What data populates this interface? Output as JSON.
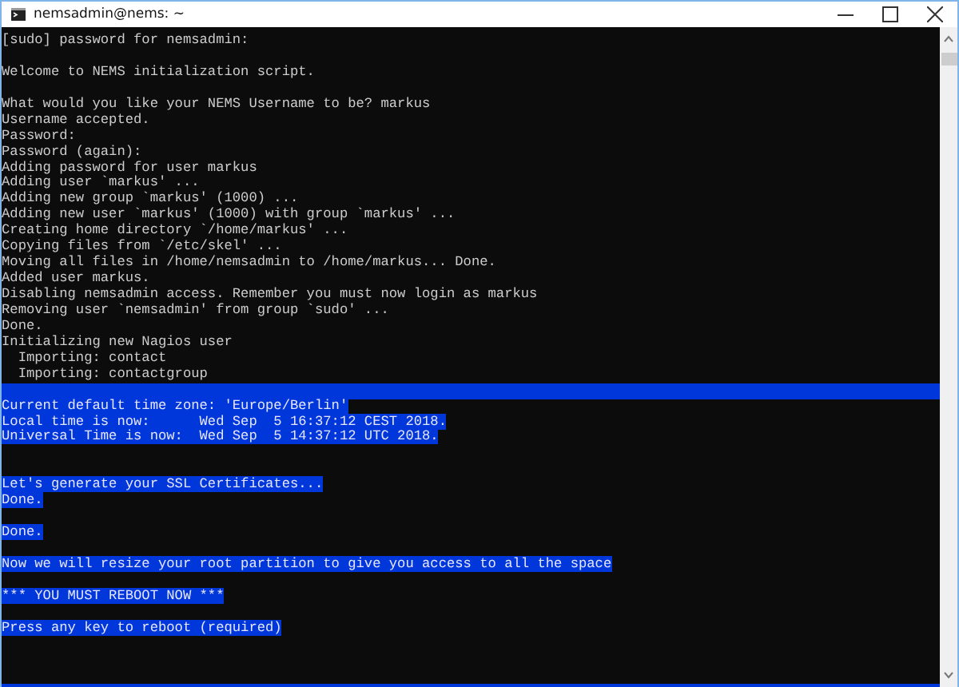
{
  "window": {
    "title": "nemsadmin@nems: ~"
  },
  "terminal": {
    "lines": [
      {
        "kind": "text",
        "text": "[sudo] password for nemsadmin:",
        "highlighted": false
      },
      {
        "kind": "blank"
      },
      {
        "kind": "text",
        "text": "Welcome to NEMS initialization script.",
        "highlighted": false
      },
      {
        "kind": "blank"
      },
      {
        "kind": "text",
        "text": "What would you like your NEMS Username to be? markus",
        "highlighted": false
      },
      {
        "kind": "text",
        "text": "Username accepted.",
        "highlighted": false
      },
      {
        "kind": "text",
        "text": "Password:",
        "highlighted": false
      },
      {
        "kind": "text",
        "text": "Password (again):",
        "highlighted": false
      },
      {
        "kind": "text",
        "text": "Adding password for user markus",
        "highlighted": false
      },
      {
        "kind": "text",
        "text": "Adding user `markus' ...",
        "highlighted": false
      },
      {
        "kind": "text",
        "text": "Adding new group `markus' (1000) ...",
        "highlighted": false
      },
      {
        "kind": "text",
        "text": "Adding new user `markus' (1000) with group `markus' ...",
        "highlighted": false
      },
      {
        "kind": "text",
        "text": "Creating home directory `/home/markus' ...",
        "highlighted": false
      },
      {
        "kind": "text",
        "text": "Copying files from `/etc/skel' ...",
        "highlighted": false
      },
      {
        "kind": "text",
        "text": "Moving all files in /home/nemsadmin to /home/markus... Done.",
        "highlighted": false
      },
      {
        "kind": "text",
        "text": "Added user markus.",
        "highlighted": false
      },
      {
        "kind": "text",
        "text": "Disabling nemsadmin access. Remember you must now login as markus",
        "highlighted": false
      },
      {
        "kind": "text",
        "text": "Removing user `nemsadmin' from group `sudo' ...",
        "highlighted": false
      },
      {
        "kind": "text",
        "text": "Done.",
        "highlighted": false
      },
      {
        "kind": "text",
        "text": "Initializing new Nagios user",
        "highlighted": false
      },
      {
        "kind": "text",
        "text": "  Importing: contact",
        "highlighted": false
      },
      {
        "kind": "text",
        "text": "  Importing: contactgroup",
        "highlighted": false
      },
      {
        "kind": "band"
      },
      {
        "kind": "text",
        "text": "Current default time zone: 'Europe/Berlin'",
        "highlighted": true
      },
      {
        "kind": "text",
        "text": "Local time is now:      Wed Sep  5 16:37:12 CEST 2018.",
        "highlighted": true
      },
      {
        "kind": "text",
        "text": "Universal Time is now:  Wed Sep  5 14:37:12 UTC 2018.",
        "highlighted": true
      },
      {
        "kind": "blank"
      },
      {
        "kind": "blank"
      },
      {
        "kind": "text",
        "text": "Let's generate your SSL Certificates...",
        "highlighted": true
      },
      {
        "kind": "text",
        "text": "Done.",
        "highlighted": true
      },
      {
        "kind": "blank"
      },
      {
        "kind": "text",
        "text": "Done.",
        "highlighted": true
      },
      {
        "kind": "blank"
      },
      {
        "kind": "text",
        "text": "Now we will resize your root partition to give you access to all the space",
        "highlighted": true
      },
      {
        "kind": "blank"
      },
      {
        "kind": "text",
        "text": "*** YOU MUST REBOOT NOW ***",
        "highlighted": true
      },
      {
        "kind": "blank"
      },
      {
        "kind": "text",
        "text": "Press any key to reboot (required)",
        "highlighted": true
      },
      {
        "kind": "blank"
      },
      {
        "kind": "blank"
      },
      {
        "kind": "blank"
      },
      {
        "kind": "band"
      }
    ]
  }
}
